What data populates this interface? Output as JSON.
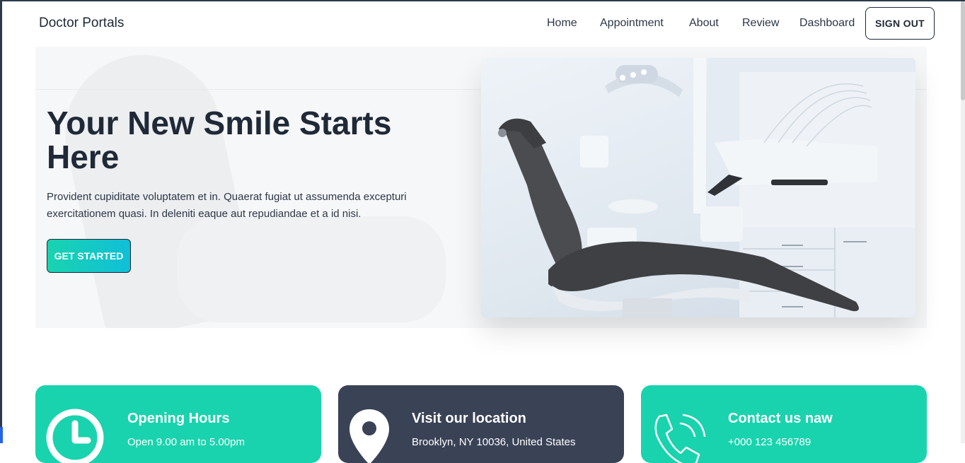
{
  "header": {
    "brand": "Doctor Portals",
    "nav": [
      "Home",
      "Appointment",
      "About",
      "Review",
      "Dashboard"
    ],
    "signout_label": "SIGN OUT"
  },
  "hero": {
    "title": "Your New Smile Starts Here",
    "description": "Provident cupiditate voluptatem et in. Quaerat fugiat ut assumenda excepturi exercitationem quasi. In deleniti eaque aut repudiandae et a id nisi.",
    "cta_label": "GET STARTED"
  },
  "cards": [
    {
      "title": "Opening Hours",
      "text": "Open 9.00 am to 5.00pm",
      "icon": "clock-icon",
      "color": "#19d3ae"
    },
    {
      "title": "Visit our location",
      "text": "Brooklyn, NY 10036, United States",
      "icon": "location-pin-icon",
      "color": "#3a4256"
    },
    {
      "title": "Contact us naw",
      "text": "+000 123 456789",
      "icon": "phone-icon",
      "color": "#19d3ae"
    }
  ],
  "colors": {
    "accent": "#19d3ae",
    "dark": "#3a4256",
    "text": "#1f2937"
  }
}
